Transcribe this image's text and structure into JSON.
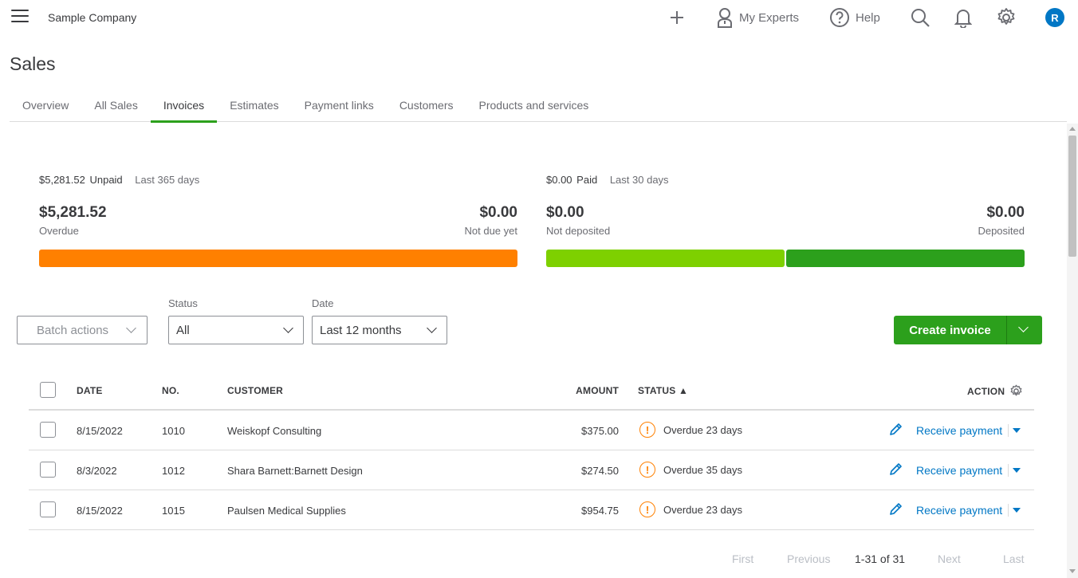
{
  "header": {
    "company": "Sample Company",
    "experts_label": "My Experts",
    "help_label": "Help",
    "avatar_initial": "R"
  },
  "page": {
    "title": "Sales"
  },
  "tabs": [
    "Overview",
    "All Sales",
    "Invoices",
    "Estimates",
    "Payment links",
    "Customers",
    "Products and services"
  ],
  "active_tab": "Invoices",
  "summary": {
    "unpaid": {
      "amount": "$5,281.52",
      "kind": "Unpaid",
      "period": "Last 365 days",
      "left_amount": "$5,281.52",
      "left_label": "Overdue",
      "right_amount": "$0.00",
      "right_label": "Not due yet",
      "overdue_fraction": 1.0
    },
    "paid": {
      "amount": "$0.00",
      "kind": "Paid",
      "period": "Last 30 days",
      "left_amount": "$0.00",
      "left_label": "Not deposited",
      "right_amount": "$0.00",
      "right_label": "Deposited",
      "not_deposited_fraction": 0.5
    }
  },
  "colors": {
    "accent_green": "#2ca01c",
    "overdue_orange": "#ff8000",
    "not_deposited_green": "#7ed000",
    "deposited_green": "#2ca01c",
    "link_blue": "#0077c5"
  },
  "filters": {
    "batch_label": "Batch actions",
    "status_label": "Status",
    "status_value": "All",
    "date_label": "Date",
    "date_value": "Last 12 months",
    "create_label": "Create invoice"
  },
  "table": {
    "headers": {
      "date": "DATE",
      "no": "NO.",
      "customer": "CUSTOMER",
      "amount": "AMOUNT",
      "status": "STATUS ▲",
      "action": "ACTION"
    },
    "rows": [
      {
        "date": "8/15/2022",
        "no": "1010",
        "customer": "Weiskopf Consulting",
        "amount": "$375.00",
        "status": "Overdue 23 days",
        "action": "Receive payment"
      },
      {
        "date": "8/3/2022",
        "no": "1012",
        "customer": "Shara Barnett:Barnett Design",
        "amount": "$274.50",
        "status": "Overdue 35 days",
        "action": "Receive payment"
      },
      {
        "date": "8/15/2022",
        "no": "1015",
        "customer": "Paulsen Medical Supplies",
        "amount": "$954.75",
        "status": "Overdue 23 days",
        "action": "Receive payment"
      }
    ]
  },
  "pagination": {
    "first": "First",
    "previous": "Previous",
    "range": "1-31 of 31",
    "next": "Next",
    "last": "Last"
  },
  "icons": {
    "menu": "hamburger-icon",
    "add": "plus-icon",
    "experts": "person-icon",
    "help": "question-icon",
    "search": "search-icon",
    "notifications": "bell-icon",
    "settings": "gear-icon",
    "edit": "pencil-icon",
    "warning": "exclamation-icon"
  }
}
